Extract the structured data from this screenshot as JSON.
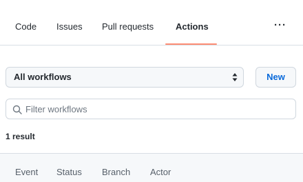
{
  "tabs": [
    {
      "label": "Code"
    },
    {
      "label": "Issues"
    },
    {
      "label": "Pull requests"
    },
    {
      "label": "Actions",
      "active": true
    }
  ],
  "more_label": "···",
  "workflow_select": {
    "value": "All workflows",
    "caret_icon": "updown-caret-icon"
  },
  "new_button": {
    "label": "New"
  },
  "filter": {
    "placeholder": "Filter workflows",
    "value": "",
    "icon": "search-icon"
  },
  "result_count": "1 result",
  "filters": [
    {
      "label": "Event"
    },
    {
      "label": "Status"
    },
    {
      "label": "Branch"
    },
    {
      "label": "Actor"
    }
  ],
  "colors": {
    "accent_underline": "#fd8c73",
    "link_blue": "#0969da",
    "border": "#d0d7de",
    "subtle_bg": "#f6f8fa"
  }
}
